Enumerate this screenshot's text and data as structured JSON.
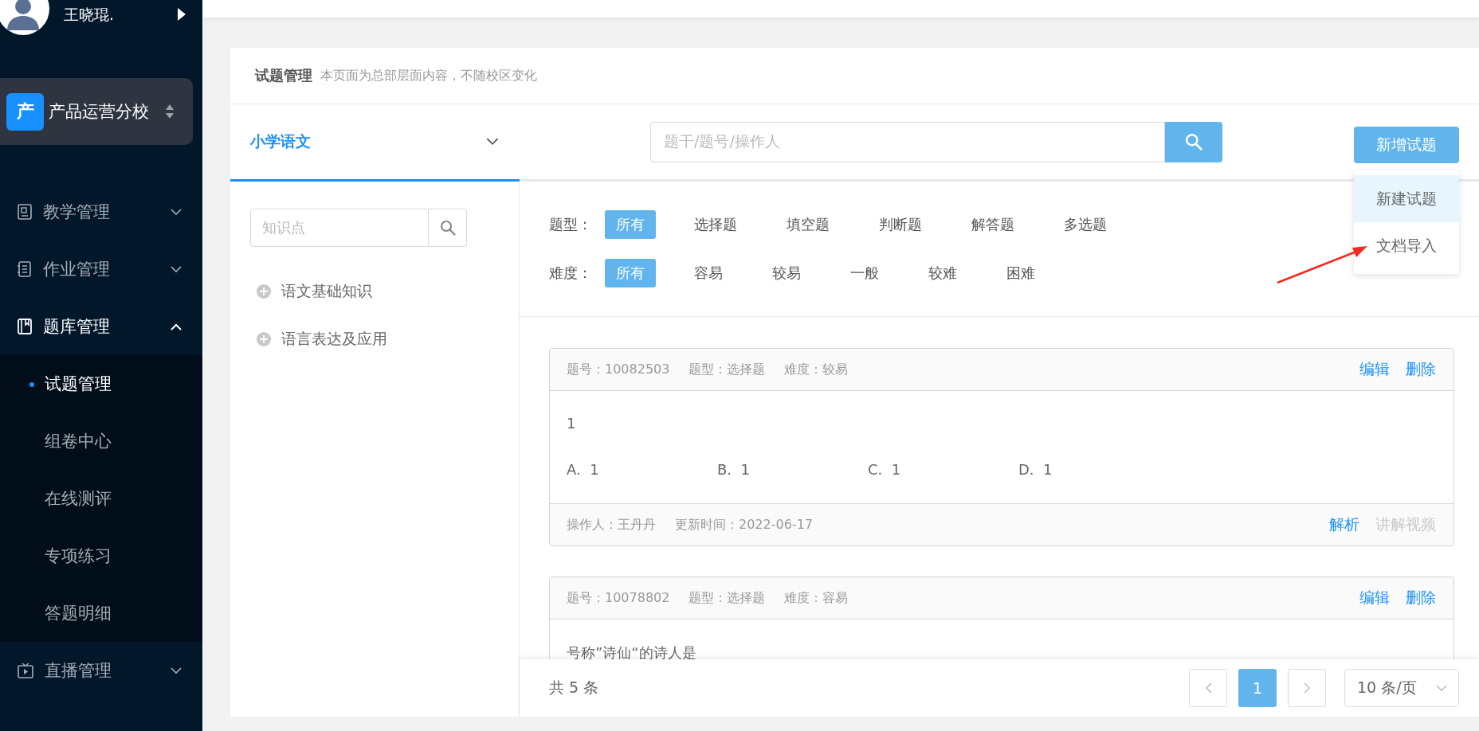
{
  "user": {
    "name": "王晓琨."
  },
  "campus": {
    "badge": "产",
    "name": "产品运营分校"
  },
  "menu": [
    {
      "label": "教学管理",
      "expanded": false
    },
    {
      "label": "作业管理",
      "expanded": false
    },
    {
      "label": "题库管理",
      "expanded": true,
      "children": [
        {
          "label": "试题管理",
          "selected": true
        },
        {
          "label": "组卷中心",
          "selected": false
        },
        {
          "label": "在线测评",
          "selected": false
        },
        {
          "label": "专项练习",
          "selected": false
        },
        {
          "label": "答题明细",
          "selected": false
        }
      ]
    },
    {
      "label": "直播管理",
      "expanded": false
    }
  ],
  "page": {
    "title": "试题管理",
    "note": "本页面为总部层面内容，不随校区变化"
  },
  "subject": {
    "label": "小学语文"
  },
  "search": {
    "placeholder": "题干/题号/操作人"
  },
  "add_button": {
    "label": "新增试题"
  },
  "add_menu": [
    {
      "label": "新建试题",
      "selected": true
    },
    {
      "label": "文档导入",
      "selected": false
    }
  ],
  "knowledge_search": {
    "placeholder": "知识点"
  },
  "knowledge_tree": [
    {
      "label": "语文基础知识",
      "expanded": false
    },
    {
      "label": "语言表达及应用",
      "expanded": false
    }
  ],
  "filters": [
    {
      "label": "题型：",
      "options": [
        {
          "label": "所有",
          "selected": true
        },
        {
          "label": "选择题",
          "selected": false
        },
        {
          "label": "填空题",
          "selected": false
        },
        {
          "label": "判断题",
          "selected": false
        },
        {
          "label": "解答题",
          "selected": false
        },
        {
          "label": "多选题",
          "selected": false
        }
      ]
    },
    {
      "label": "难度：",
      "options": [
        {
          "label": "所有",
          "selected": true
        },
        {
          "label": "容易",
          "selected": false
        },
        {
          "label": "较易",
          "selected": false
        },
        {
          "label": "一般",
          "selected": false
        },
        {
          "label": "较难",
          "selected": false
        },
        {
          "label": "困难",
          "selected": false
        }
      ]
    }
  ],
  "questions": [
    {
      "meta": [
        "题号：10082503",
        "题型：选择题",
        "难度：较易"
      ],
      "actions": [
        {
          "label": "编辑",
          "disabled": false
        },
        {
          "label": "删除",
          "disabled": false
        }
      ],
      "stem": "1",
      "options": [
        {
          "letter": "A.",
          "text": "1"
        },
        {
          "letter": "B.",
          "text": "1"
        },
        {
          "letter": "C.",
          "text": "1"
        },
        {
          "letter": "D.",
          "text": "1"
        }
      ],
      "footer": [
        "操作人：王丹丹",
        "更新时间：2022-06-17"
      ],
      "footer_actions": [
        {
          "label": "解析",
          "disabled": false
        },
        {
          "label": "讲解视频",
          "disabled": true
        }
      ]
    },
    {
      "meta": [
        "题号：10078802",
        "题型：选择题",
        "难度：容易"
      ],
      "actions": [
        {
          "label": "编辑",
          "disabled": false
        },
        {
          "label": "删除",
          "disabled": false
        }
      ],
      "stem": "号称”诗仙“的诗人是"
    }
  ],
  "pagination": {
    "total": "共 5 条",
    "pages": [
      {
        "label": "1",
        "selected": true
      }
    ],
    "page_size": "10 条/页"
  }
}
